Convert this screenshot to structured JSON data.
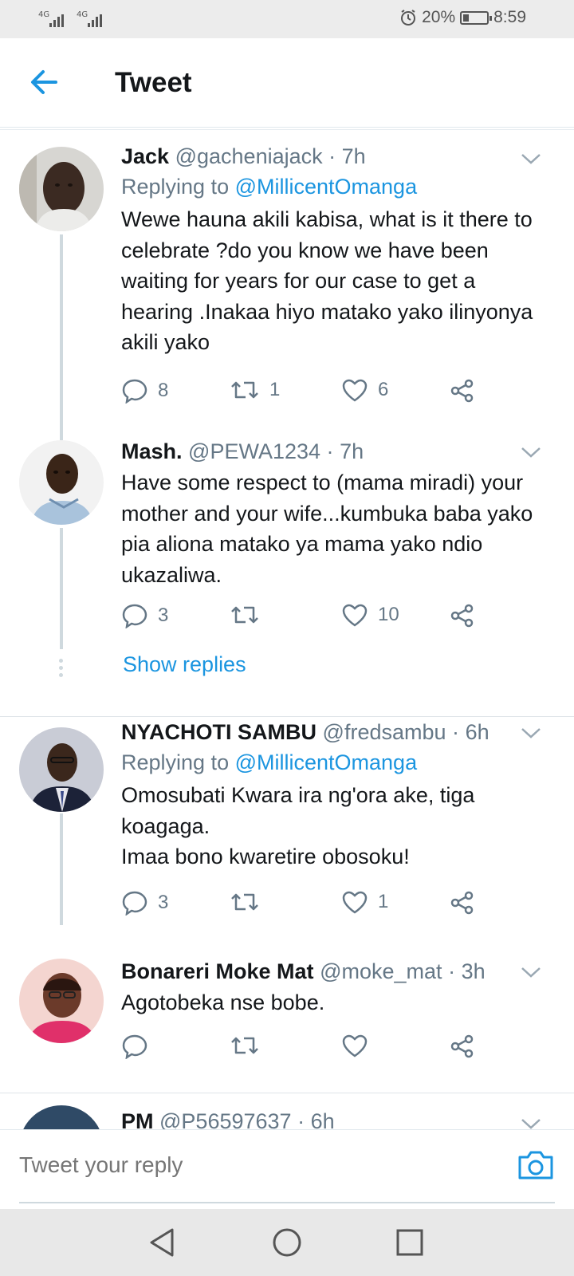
{
  "status_bar": {
    "network1": "4G",
    "network2": "4G",
    "battery": "20%",
    "battery_level": 0.2,
    "time": "8:59",
    "icons": [
      "signal-icon",
      "alarm-icon",
      "battery-icon"
    ]
  },
  "header": {
    "title": "Tweet",
    "back_icon": "back-arrow-icon"
  },
  "tweets": [
    {
      "name": "Jack",
      "handle": "@gacheniajack",
      "time": "7h",
      "reply_prefix": "Replying to",
      "reply_to": "@MillicentOmanga",
      "text": "Wewe hauna akili kabisa, what is it there to celebrate ?do you know we have been waiting  for years for our case to get a hearing .Inakaa hiyo matako yako ilinyonya akili yako",
      "replies": "8",
      "retweets": "1",
      "likes": "6"
    },
    {
      "name": "Mash.",
      "handle": "@PEWA1234",
      "time": "7h",
      "text": "Have some respect to (mama miradi) your mother and your wife...kumbuka baba yako pia aliona matako ya mama yako ndio ukazaliwa.",
      "replies": "3",
      "retweets": "",
      "likes": "10"
    },
    {
      "name": "NYACHOTI SAMBU",
      "handle": "@fredsambu",
      "time": "6h",
      "reply_prefix": "Replying to",
      "reply_to": "@MillicentOmanga",
      "text_lines": [
        "Omosubati Kwara ira ng'ora ake, tiga koagaga.",
        "Imaa bono kwaretire obosoku!"
      ],
      "replies": "3",
      "retweets": "",
      "likes": "1"
    },
    {
      "name": "Bonareri Moke Mat",
      "handle": "@moke_mat",
      "time": "3h",
      "text": "Agotobeka nse bobe.",
      "replies": "",
      "retweets": "",
      "likes": ""
    },
    {
      "name": "PM",
      "handle": "@P56597637",
      "time": "6h"
    }
  ],
  "show_replies": "Show replies",
  "separator": "·",
  "reply_bar": {
    "placeholder": "Tweet your reply",
    "camera_icon": "camera-icon"
  },
  "nav": {
    "icons": [
      "nav-back-icon",
      "nav-home-icon",
      "nav-recents-icon"
    ]
  },
  "colors": {
    "accent": "#1b95e0",
    "muted": "#657786",
    "thread_line": "#cfd9de"
  }
}
